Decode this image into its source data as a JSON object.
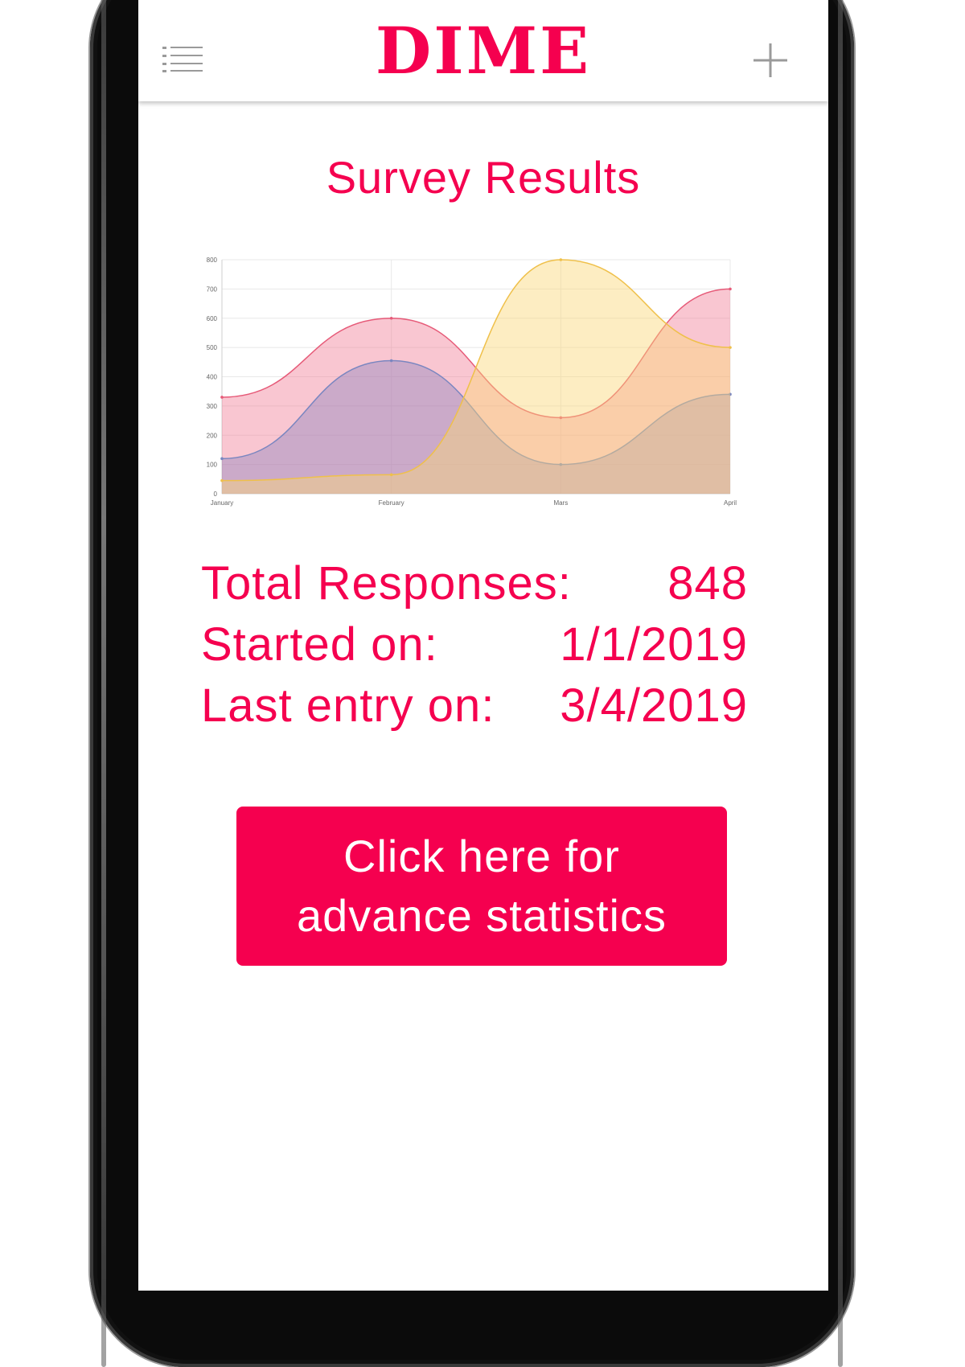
{
  "colors": {
    "accent": "#f5004f",
    "icon_gray": "#9a9a9a",
    "button_text": "#ffffff"
  },
  "header": {
    "brand": "DIME",
    "menu_icon": "list-menu-icon",
    "add_icon": "plus-icon"
  },
  "main": {
    "title": "Survey Results",
    "stats": [
      {
        "label": "Total Responses:",
        "value": "848"
      },
      {
        "label": "Started on:",
        "value": "1/1/2019"
      },
      {
        "label": "Last entry on:",
        "value": "3/4/2019"
      }
    ],
    "button_line1": "Click here for",
    "button_line2": "advance statistics"
  },
  "chart_data": {
    "type": "area",
    "categories": [
      "January",
      "February",
      "Mars",
      "April"
    ],
    "ylim": [
      0,
      800
    ],
    "y_ticks": [
      0,
      100,
      200,
      300,
      400,
      500,
      600,
      700,
      800
    ],
    "grid": true,
    "smooth": true,
    "series": [
      {
        "values": [
          330,
          600,
          260,
          700
        ],
        "stroke": "#e65a78",
        "fill": "rgba(240,120,145,0.42)"
      },
      {
        "values": [
          120,
          455,
          100,
          340
        ],
        "stroke": "#7a86c0",
        "fill": "rgba(140,130,190,0.42)"
      },
      {
        "values": [
          45,
          65,
          800,
          500
        ],
        "stroke": "#efc04a",
        "fill": "rgba(250,215,120,0.45)"
      }
    ]
  }
}
